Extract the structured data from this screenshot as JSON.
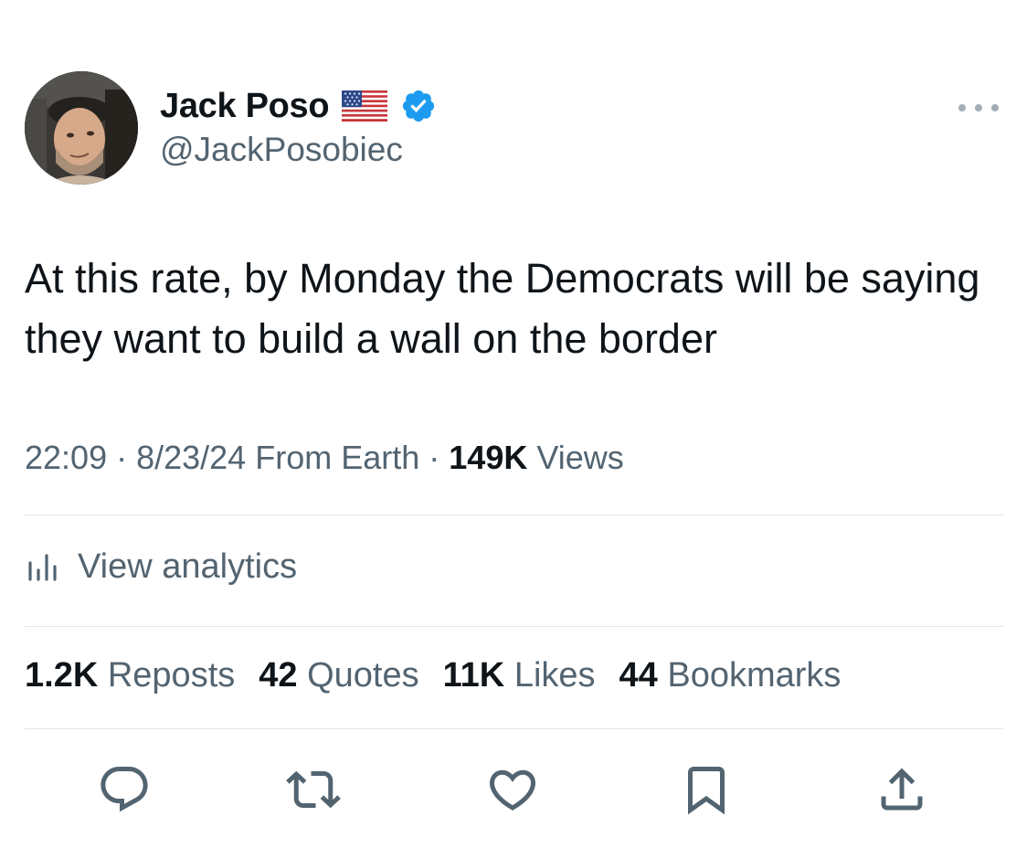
{
  "author": {
    "display_name": "Jack Poso",
    "handle": "@JackPosobiec",
    "avatar_icon": "profile-photo",
    "flag_icon": "us-flag-emoji",
    "verified_icon": "verified-badge",
    "verified_color": "#1d9bf0"
  },
  "tweet": {
    "text": "At this rate, by Monday the Democrats will be saying they want to build a wall on the border",
    "time": "22:09",
    "date": "8/23/24",
    "source": "From Earth",
    "views_count": "149K",
    "views_label": "Views"
  },
  "analytics": {
    "label": "View analytics"
  },
  "stats": [
    {
      "count": "1.2K",
      "label": "Reposts"
    },
    {
      "count": "42",
      "label": "Quotes"
    },
    {
      "count": "11K",
      "label": "Likes"
    },
    {
      "count": "44",
      "label": "Bookmarks"
    }
  ],
  "actions": [
    "reply-icon",
    "repost-icon",
    "like-icon",
    "bookmark-icon",
    "share-icon"
  ],
  "colors": {
    "text_primary": "#0f1419",
    "text_secondary": "#536471",
    "divider": "#e3e7ea",
    "accent": "#1d9bf0"
  }
}
